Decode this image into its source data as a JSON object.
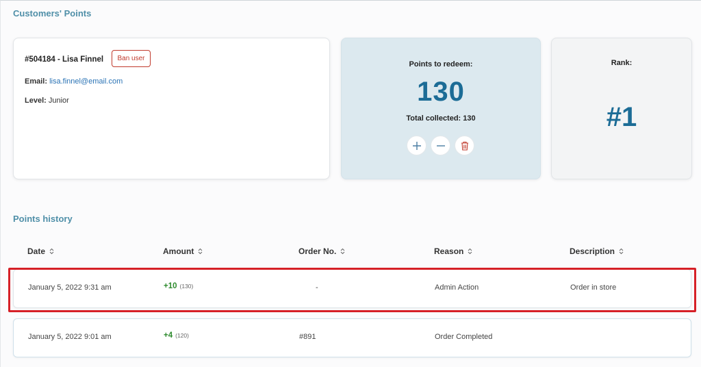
{
  "customers_points": {
    "title": "Customers' Points",
    "user": {
      "name": "#504184 - Lisa Finnel",
      "ban_label": "Ban user",
      "email_label": "Email:",
      "email": "lisa.finnel@email.com",
      "level_label": "Level:",
      "level": "Junior"
    },
    "points": {
      "redeem_label": "Points to redeem:",
      "redeem_value": "130",
      "total_collected": "Total collected: 130",
      "actions": [
        "plus-icon",
        "minus-icon",
        "trash-icon"
      ]
    },
    "rank": {
      "label": "Rank:",
      "value": "#1"
    }
  },
  "points_history": {
    "title": "Points history",
    "columns": [
      "Date",
      "Amount",
      "Order No.",
      "Reason",
      "Description"
    ],
    "rows": [
      {
        "date": "January 5, 2022 9:31 am",
        "amount": "+10",
        "balance": "(130)",
        "order": "-",
        "reason": "Admin Action",
        "description": "Order in store"
      },
      {
        "date": "January 5, 2022 9:01 am",
        "amount": "+4",
        "balance": "(120)",
        "order": "#891",
        "reason": "Order Completed",
        "description": ""
      }
    ]
  },
  "colors": {
    "accent": "#1c6c96",
    "section_title": "#4f8fa8",
    "link": "#2a73b5",
    "amount_positive": "#2e8b2e",
    "danger": "#c0392b",
    "highlight_border": "#d62027"
  }
}
